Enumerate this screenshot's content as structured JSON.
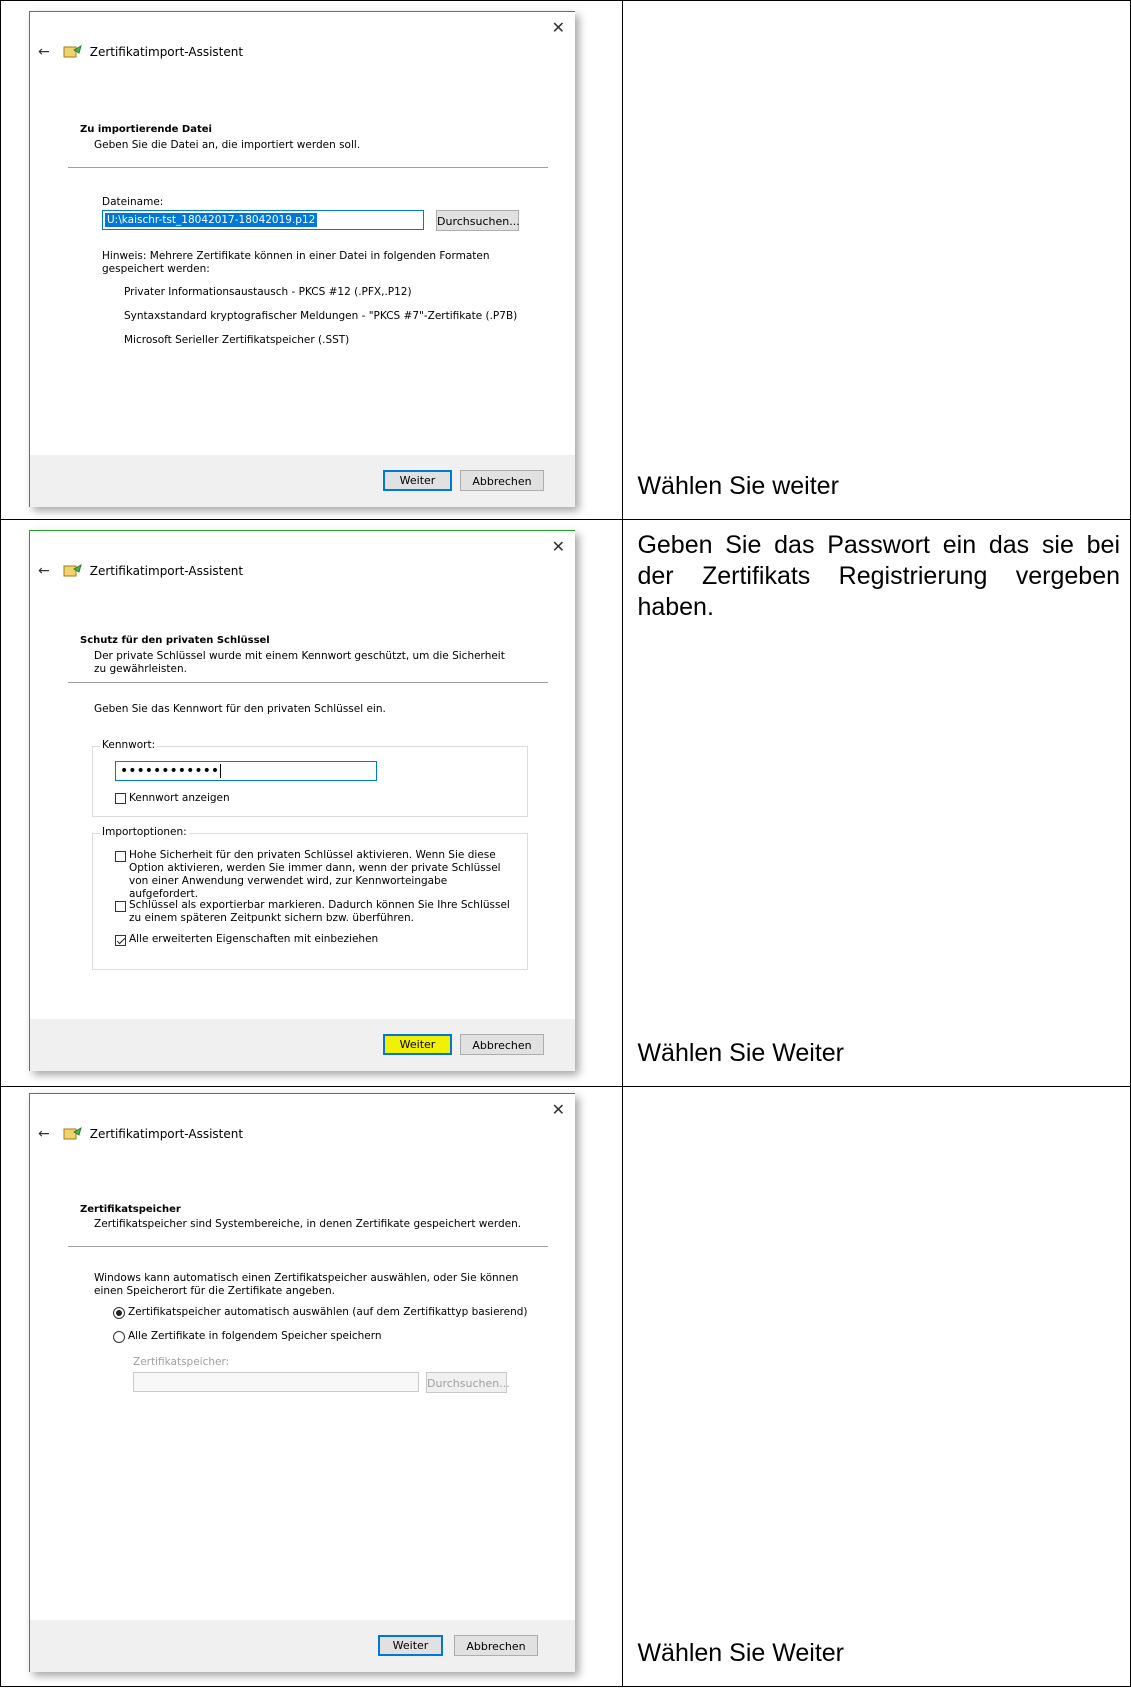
{
  "rows": [
    {
      "instruction_top": "",
      "instruction_bottom": "Wählen Sie weiter",
      "dialog": {
        "title": "Zertifikatimport-Assistent",
        "section_title": "Zu importierende Datei",
        "section_subtitle": "Geben Sie die Datei an, die importiert werden soll.",
        "filename_label": "Dateiname:",
        "filename_value": "U:\\kaischr-tst_18042017-18042019.p12",
        "browse_label": "Durchsuchen...",
        "hint": "Hinweis: Mehrere Zertifikate können in einer Datei in folgenden Formaten gespeichert werden:",
        "formats": [
          "Privater Informationsaustausch - PKCS #12 (.PFX,.P12)",
          "Syntaxstandard kryptografischer Meldungen - \"PKCS #7\"-Zertifikate (.P7B)",
          "Microsoft Serieller Zertifikatspeicher (.SST)"
        ],
        "next_label": "Weiter",
        "cancel_label": "Abbrechen"
      }
    },
    {
      "instruction_top": "Geben Sie das Passwort ein das sie bei der Zertifikats Registrierung vergeben haben.",
      "instruction_bottom": "Wählen Sie Weiter",
      "dialog": {
        "title": "Zertifikatimport-Assistent",
        "section_title": "Schutz für den privaten Schlüssel",
        "section_subtitle": "Der private Schlüssel wurde mit einem Kennwort geschützt, um die Sicherheit zu gewährleisten.",
        "prompt": "Geben Sie das Kennwort für den privaten Schlüssel ein.",
        "password_label": "Kennwort:",
        "password_value": "••••••••••••",
        "show_password_label": "Kennwort anzeigen",
        "import_options_label": "Importoptionen:",
        "options": [
          {
            "label": "Hohe Sicherheit für den privaten Schlüssel aktivieren. Wenn Sie diese Option aktivieren, werden Sie immer dann, wenn der private Schlüssel von einer Anwendung verwendet wird, zur Kennworteingabe aufgefordert.",
            "checked": false
          },
          {
            "label": "Schlüssel als exportierbar markieren. Dadurch können Sie Ihre Schlüssel zu einem späteren Zeitpunkt sichern bzw. überführen.",
            "checked": false
          },
          {
            "label": "Alle erweiterten Eigenschaften mit einbeziehen",
            "checked": true
          }
        ],
        "next_label": "Weiter",
        "cancel_label": "Abbrechen"
      }
    },
    {
      "instruction_top": "",
      "instruction_bottom": "Wählen Sie Weiter",
      "dialog": {
        "title": "Zertifikatimport-Assistent",
        "section_title": "Zertifikatspeicher",
        "section_subtitle": "Zertifikatspeicher sind Systembereiche, in denen Zertifikate gespeichert werden.",
        "intro": "Windows kann automatisch einen Zertifikatspeicher auswählen, oder Sie können einen Speicherort für die Zertifikate angeben.",
        "radio_auto": "Zertifikatspeicher automatisch auswählen (auf dem Zertifikattyp basierend)",
        "radio_manual": "Alle Zertifikate in folgendem Speicher speichern",
        "store_label": "Zertifikatspeicher:",
        "browse_label": "Durchsuchen...",
        "next_label": "Weiter",
        "cancel_label": "Abbrechen"
      }
    }
  ]
}
